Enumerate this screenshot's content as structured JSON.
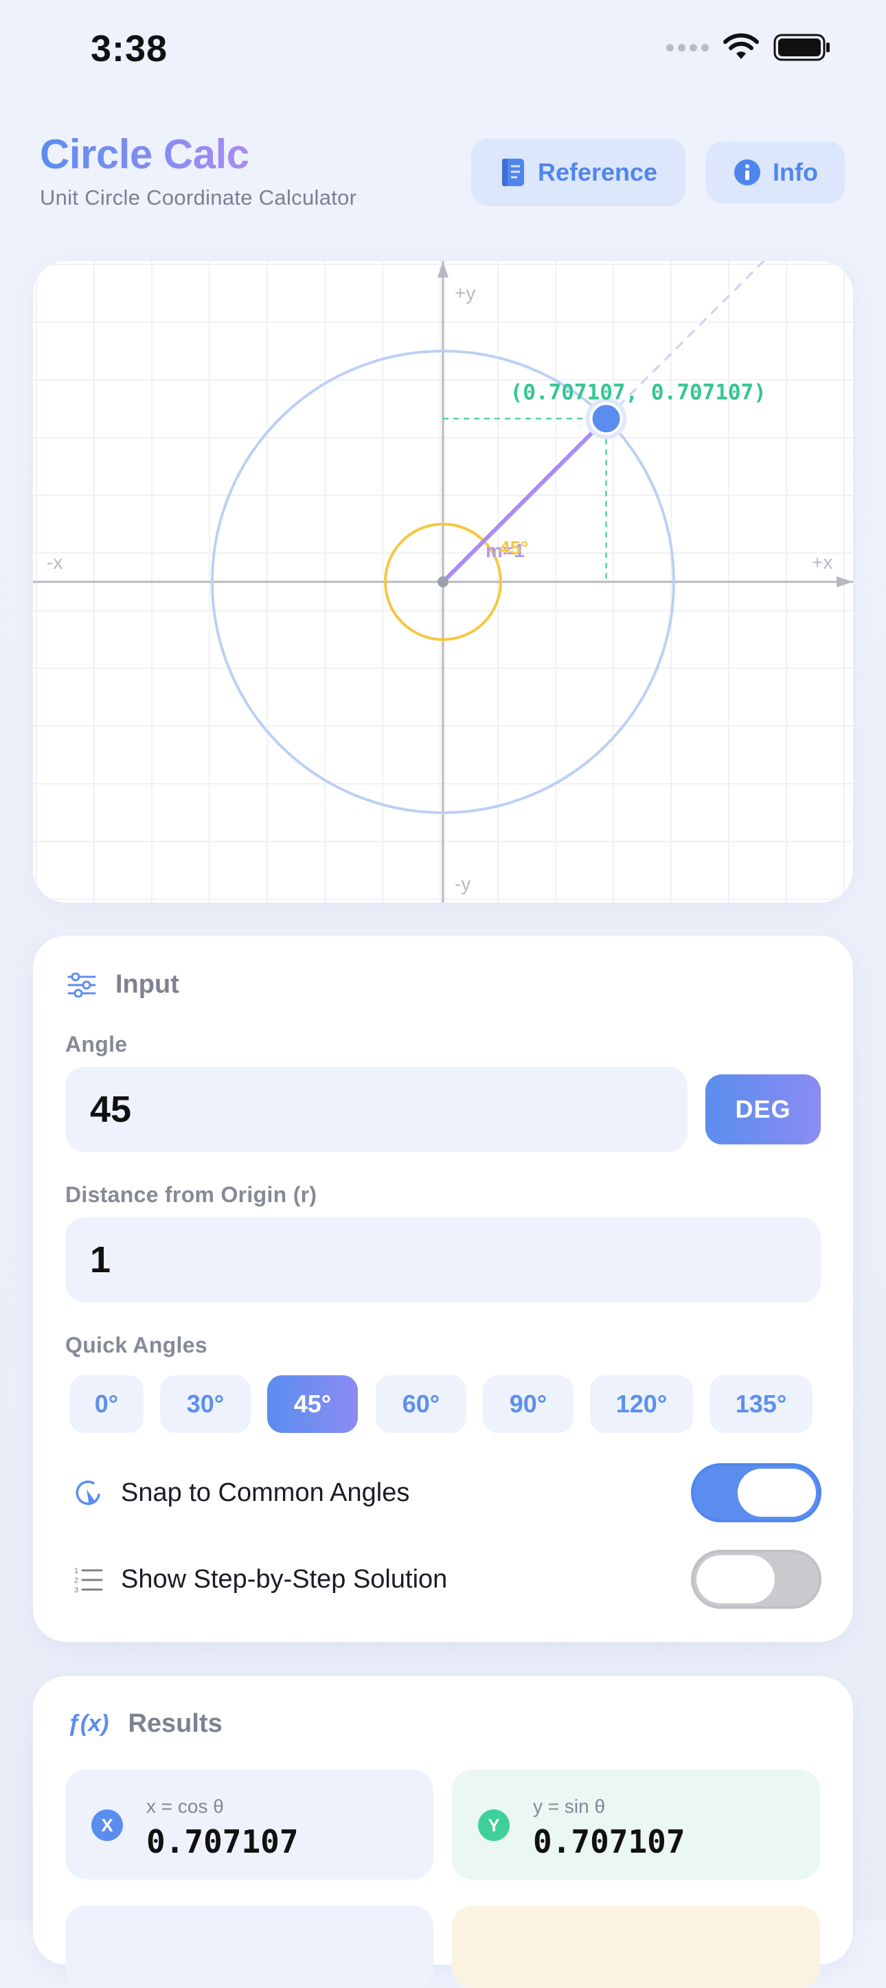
{
  "status": {
    "time": "3:38"
  },
  "header": {
    "title": "Circle Calc",
    "subtitle": "Unit Circle Coordinate Calculator",
    "reference_label": "Reference",
    "info_label": "Info"
  },
  "graph": {
    "angle_deg": 45,
    "radius": 1,
    "axis_labels": {
      "pos_y": "+y",
      "neg_y": "-y",
      "neg_x": "-x",
      "pos_x": "+x"
    },
    "point_label": "(0.707107, 0.707107)",
    "angle_label": "45°",
    "slope_label": "m=1",
    "colors": {
      "circle": "#bcd0f5",
      "arc": "#f5c842",
      "radius_line": "#a98cf2",
      "point": "#5b8def",
      "coords": "#34c594"
    }
  },
  "input": {
    "title": "Input",
    "angle_label": "Angle",
    "angle_value": "45",
    "unit_button": "DEG",
    "distance_label": "Distance from Origin (r)",
    "distance_value": "1",
    "quick_label": "Quick Angles",
    "quick_angles": [
      "0°",
      "30°",
      "45°",
      "60°",
      "90°",
      "120°",
      "135°"
    ],
    "quick_selected": "45°",
    "snap_label": "Snap to Common Angles",
    "snap_on": true,
    "steps_label": "Show Step-by-Step Solution",
    "steps_on": false
  },
  "results": {
    "title": "Results",
    "icon_text": "ƒ(x)",
    "x_badge": "X",
    "x_label": "x = cos θ",
    "x_value": "0.707107",
    "y_badge": "Y",
    "y_label": "y = sin θ",
    "y_value": "0.707107"
  }
}
